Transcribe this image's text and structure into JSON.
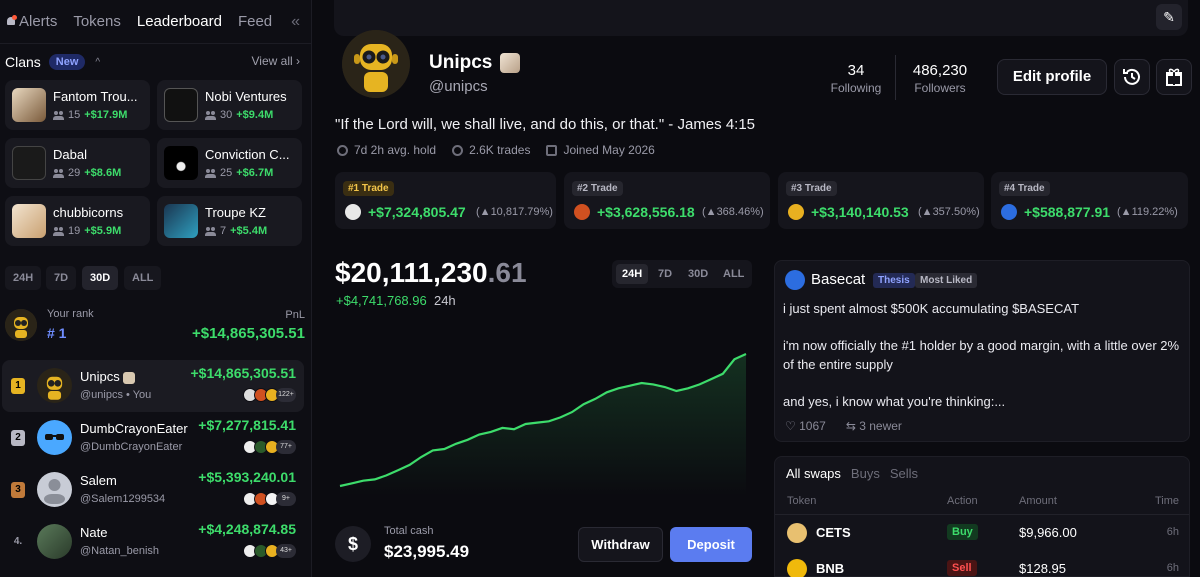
{
  "nav": {
    "tabs": [
      "Alerts",
      "Tokens",
      "Leaderboard",
      "Feed"
    ],
    "active": "Leaderboard"
  },
  "clans": {
    "title": "Clans",
    "badge": "New",
    "view_all": "View all",
    "items": [
      {
        "name": "Fantom Trou...",
        "members": "15",
        "pnl": "+$17.9M"
      },
      {
        "name": "Nobi Ventures",
        "members": "30",
        "pnl": "+$9.4M"
      },
      {
        "name": "Dabal",
        "members": "29",
        "pnl": "+$8.6M"
      },
      {
        "name": "Conviction C...",
        "members": "25",
        "pnl": "+$6.7M"
      },
      {
        "name": "chubbicorns",
        "members": "19",
        "pnl": "+$5.9M"
      },
      {
        "name": "Troupe KZ",
        "members": "7",
        "pnl": "+$5.4M"
      }
    ]
  },
  "leaderboard": {
    "timeframes": [
      "24H",
      "7D",
      "30D",
      "ALL"
    ],
    "active_timeframe": "30D",
    "your_rank_label": "Your rank",
    "your_rank_value": "# 1",
    "pnl_label": "PnL",
    "your_pnl": "+$14,865,305.51",
    "rows": [
      {
        "rank": "1",
        "name": "Unipcs",
        "handle": "@unipcs • You",
        "pnl": "+$14,865,305.51",
        "more": "122+"
      },
      {
        "rank": "2",
        "name": "DumbCrayonEater",
        "handle": "@DumbCrayonEater",
        "pnl": "+$7,277,815.41",
        "more": "77+"
      },
      {
        "rank": "3",
        "name": "Salem",
        "handle": "@Salem1299534",
        "pnl": "+$5,393,240.01",
        "more": "9+"
      },
      {
        "rank": "4.",
        "name": "Nate",
        "handle": "@Natan_benish",
        "pnl": "+$4,248,874.85",
        "more": "43+"
      }
    ]
  },
  "profile": {
    "name": "Unipcs",
    "handle": "@unipcs",
    "following_count": "34",
    "following_label": "Following",
    "followers_count": "486,230",
    "followers_label": "Followers",
    "edit_label": "Edit profile",
    "bio": "\"If the Lord will, we shall live, and do this, or that.\" - James 4:15",
    "avg_hold": "7d 2h avg. hold",
    "trades": "2.6K trades",
    "joined": "Joined May 2026"
  },
  "top_trades": [
    {
      "tag": "#1 Trade",
      "amount": "+$7,324,805.47",
      "pct": "10,817.79%"
    },
    {
      "tag": "#2 Trade",
      "amount": "+$3,628,556.18",
      "pct": "368.46%"
    },
    {
      "tag": "#3 Trade",
      "amount": "+$3,140,140.53",
      "pct": "357.50%"
    },
    {
      "tag": "#4 Trade",
      "amount": "+$588,877.91",
      "pct": "119.22%"
    }
  ],
  "portfolio": {
    "balance_int": "$20,111,230",
    "balance_dec": ".61",
    "change": "+$4,741,768.96",
    "change_period": "24h",
    "timeframes": [
      "24H",
      "7D",
      "30D",
      "ALL"
    ],
    "active_timeframe": "24H",
    "cash_label": "Total cash",
    "cash_value": "$23,995.49",
    "withdraw_label": "Withdraw",
    "deposit_label": "Deposit"
  },
  "chart_data": {
    "type": "area",
    "title": "",
    "xlabel": "",
    "ylabel": "",
    "series": [
      {
        "values": [
          0.0,
          0.02,
          0.04,
          0.05,
          0.08,
          0.12,
          0.16,
          0.22,
          0.27,
          0.28,
          0.32,
          0.35,
          0.39,
          0.41,
          0.44,
          0.43,
          0.47,
          0.48,
          0.49,
          0.52,
          0.56,
          0.62,
          0.66,
          0.71,
          0.74,
          0.76,
          0.78,
          0.77,
          0.75,
          0.72,
          0.74,
          0.77,
          0.81,
          0.85,
          0.96,
          1.0
        ]
      }
    ],
    "line_color": "#3ddc6b"
  },
  "post": {
    "author": "Basecat",
    "tag1": "Thesis",
    "tag2": "Most Liked",
    "paragraphs": [
      "i just spent almost $500K accumulating $BASECAT",
      "i'm now officially the #1 holder by a good margin, with a little over 2% of the entire supply",
      "and yes, i know what you're thinking:..."
    ],
    "likes": "1067",
    "newer": "3 newer"
  },
  "swaps": {
    "tabs": [
      "All swaps",
      "Buys",
      "Sells"
    ],
    "active": "All swaps",
    "headers": [
      "Token",
      "Action",
      "Amount",
      "Time"
    ],
    "rows": [
      {
        "token": "CETS",
        "action": "Buy",
        "amount": "$9,966.00",
        "time": "6h"
      },
      {
        "token": "BNB",
        "action": "Sell",
        "amount": "$128.95",
        "time": "6h"
      }
    ]
  }
}
